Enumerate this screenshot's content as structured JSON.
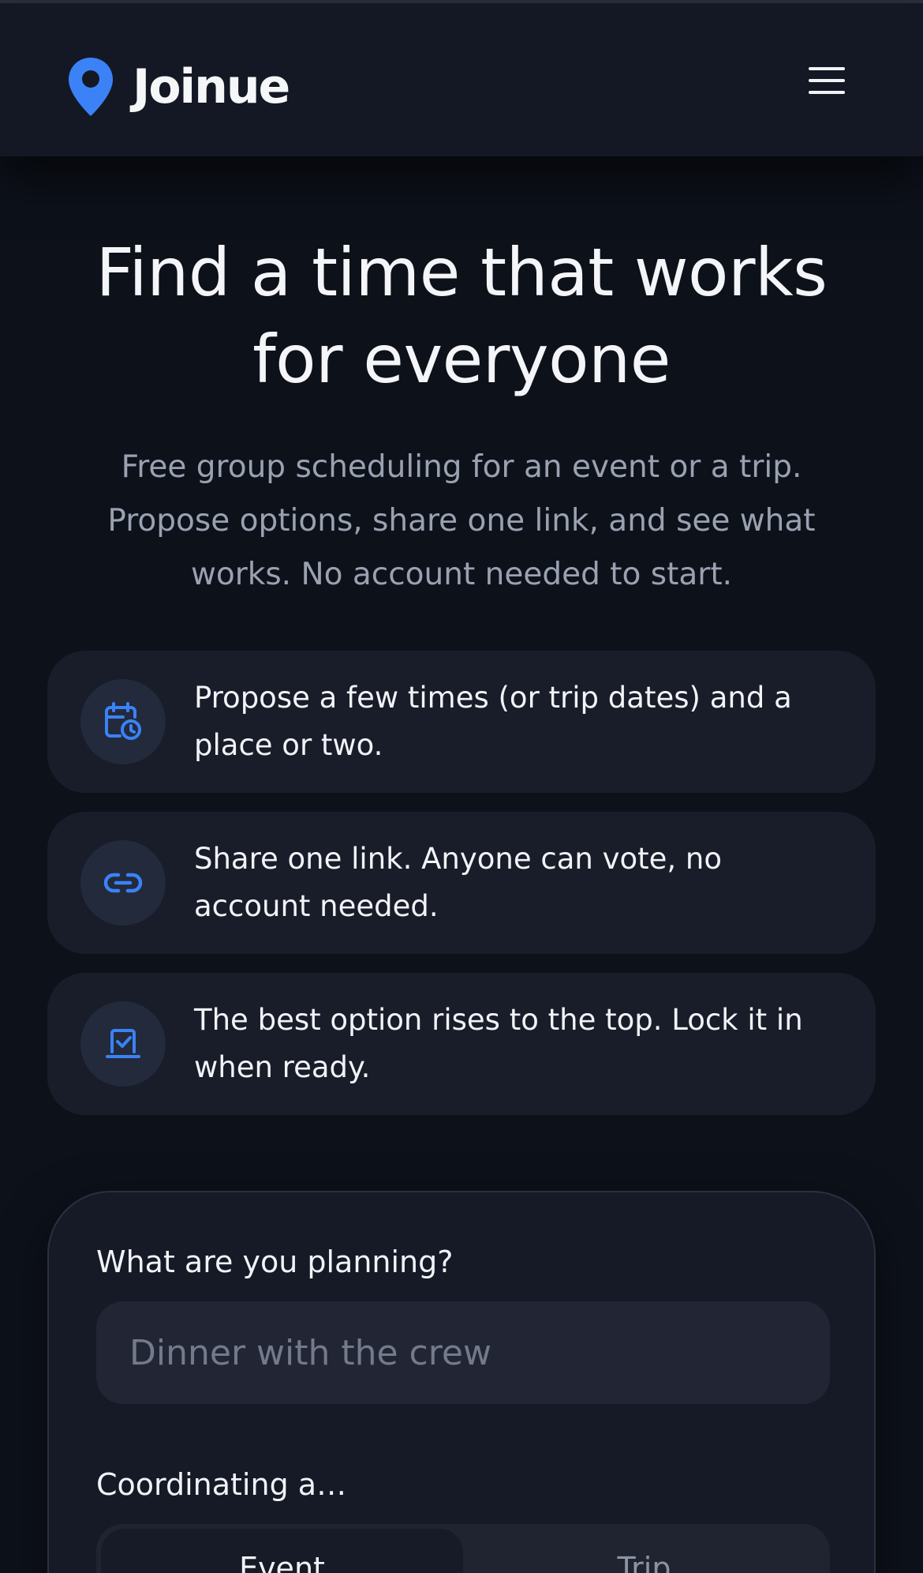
{
  "header": {
    "brand_name": "Joinue",
    "menu_icon": "hamburger-menu-icon",
    "brand_icon": "map-pin-icon",
    "accent_color": "#3b82f6"
  },
  "hero": {
    "title": "Find a time that works for everyone",
    "subtitle": "Free group scheduling for an event or a trip. Propose options, share one link, and see what works. No account needed to start."
  },
  "features": [
    {
      "icon": "calendar-clock-icon",
      "text": "Propose a few times (or trip dates) and a place or two."
    },
    {
      "icon": "link-icon",
      "text": "Share one link. Anyone can vote, no account needed."
    },
    {
      "icon": "checkbox-icon",
      "text": "The best option rises to the top. Lock it in when ready."
    }
  ],
  "form": {
    "plan_label": "What are you planning?",
    "plan_placeholder": "Dinner with the crew",
    "plan_value": "",
    "coordinating_label": "Coordinating a…",
    "options": [
      {
        "label": "Event",
        "selected": true
      },
      {
        "label": "Trip",
        "selected": false
      }
    ]
  }
}
